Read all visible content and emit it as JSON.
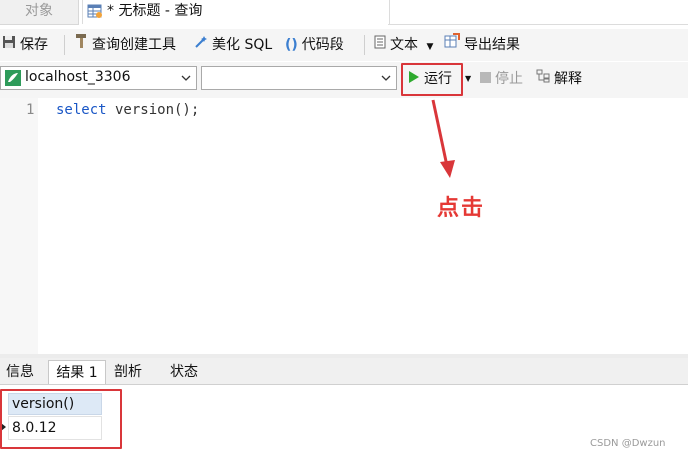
{
  "tabs": {
    "objects": "对象",
    "query": "* 无标题 - 查询"
  },
  "toolbar": {
    "save": "保存",
    "query_builder": "查询创建工具",
    "beautify_sql": "美化 SQL",
    "code_snippet": "代码段",
    "text": "文本",
    "export_results": "导出结果"
  },
  "connection": {
    "selected": "localhost_3306",
    "database": ""
  },
  "run_bar": {
    "run": "运行",
    "stop": "停止",
    "explain": "解释"
  },
  "editor": {
    "line_number": "1",
    "keyword": "select",
    "rest": " version();"
  },
  "annotation": {
    "label": "点击"
  },
  "result_tabs": {
    "info": "信息",
    "result1": "结果 1",
    "profile": "剖析",
    "status": "状态"
  },
  "grid": {
    "column": "version()",
    "value": "8.0.12"
  },
  "watermark": "CSDN @Dwzun",
  "colors": {
    "annotation_red": "#e53935",
    "run_green": "#2eaa2e",
    "keyword_blue": "#1a57c6"
  }
}
